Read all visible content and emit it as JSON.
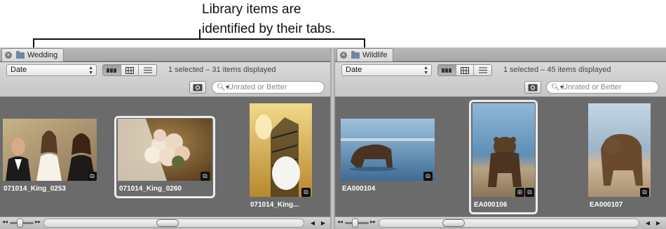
{
  "callout": {
    "line1": "Library items are",
    "line2": "identified by their tabs."
  },
  "panels": [
    {
      "tab_label": "Wedding",
      "sort_value": "Date",
      "status": "1 selected – 31 items displayed",
      "search_placeholder": "Unrated or Better",
      "items": [
        {
          "caption": "071014_King_0253"
        },
        {
          "caption": "071014_King_0260"
        },
        {
          "caption": "071014_King..."
        }
      ]
    },
    {
      "tab_label": "Wildlife",
      "sort_value": "Date",
      "status": "1 selected – 45 items displayed",
      "search_placeholder": "Unrated or Better",
      "items": [
        {
          "caption": "EA000104"
        },
        {
          "caption": "EA000106"
        },
        {
          "caption": "EA000107"
        }
      ]
    }
  ],
  "icons": {
    "tab_close": "close-icon",
    "tab_folder": "folder-icon",
    "view_filmstrip": "filmstrip-view-icon",
    "view_grid": "grid-view-icon",
    "view_list": "list-view-icon",
    "filter": "filter-hud-icon",
    "search": "search-icon",
    "badge": "managed-file-badge-icon"
  },
  "colors": {
    "panel_bg": "#6b6b6b",
    "selection_frame": "#ececec",
    "caption": "#ffffff"
  }
}
